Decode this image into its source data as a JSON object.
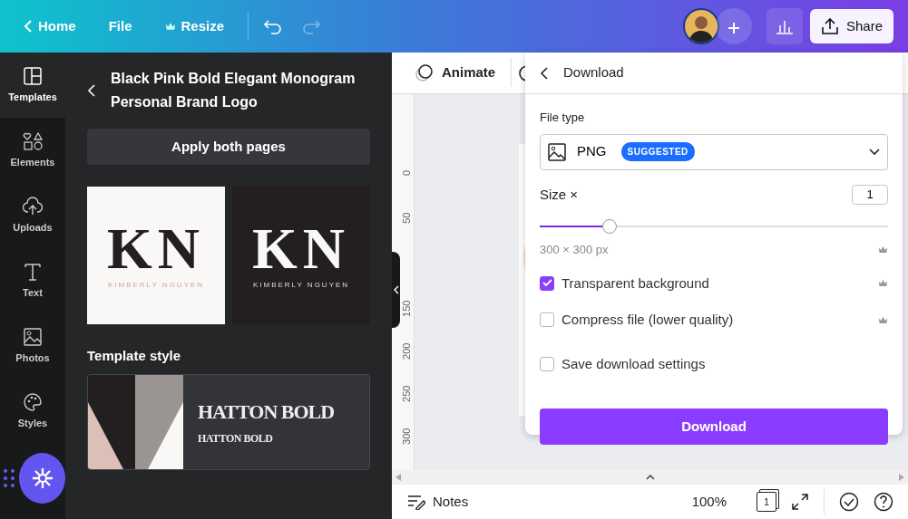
{
  "topbar": {
    "back_label": "Home",
    "menu": [
      {
        "label": "File",
        "premium": false
      },
      {
        "label": "Resize",
        "premium": true
      }
    ],
    "share": "Share"
  },
  "rail": [
    {
      "label": "Templates",
      "selected": true
    },
    {
      "label": "Elements",
      "selected": false
    },
    {
      "label": "Uploads",
      "selected": false
    },
    {
      "label": "Text",
      "selected": false
    },
    {
      "label": "Photos",
      "selected": false
    },
    {
      "label": "Styles",
      "selected": false
    }
  ],
  "panel": {
    "title": "Black Pink Bold Elegant Monogram Personal Brand Logo",
    "apply": "Apply both pages",
    "previews": [
      {
        "monogram": "KN",
        "name": "KIMBERLY NGUYEN"
      },
      {
        "monogram": "KN",
        "name": "KIMBERLY NGUYEN"
      }
    ],
    "style_heading": "Template style",
    "style_card": {
      "font_large": "HATTON BOLD",
      "font_small": "HATTON BOLD"
    }
  },
  "toolbar": {
    "animate": "Animate"
  },
  "ruler": [
    "0",
    "50",
    "150",
    "200",
    "250",
    "300"
  ],
  "download": {
    "title": "Download",
    "file_type_label": "File type",
    "file_type": "PNG",
    "badge": "SUGGESTED",
    "size_label": "Size ×",
    "size_value": "1",
    "size_slider": {
      "level": 0.2
    },
    "dimensions": "300 × 300 px",
    "options": [
      {
        "label": "Transparent background",
        "checked": true,
        "premium": true
      },
      {
        "label": "Compress file (lower quality)",
        "checked": false,
        "premium": true
      },
      {
        "label": "Save download settings",
        "checked": false,
        "premium": false
      }
    ],
    "button": "Download"
  },
  "bottom": {
    "notes": "Notes",
    "zoom": "100%",
    "page_count": "1"
  }
}
